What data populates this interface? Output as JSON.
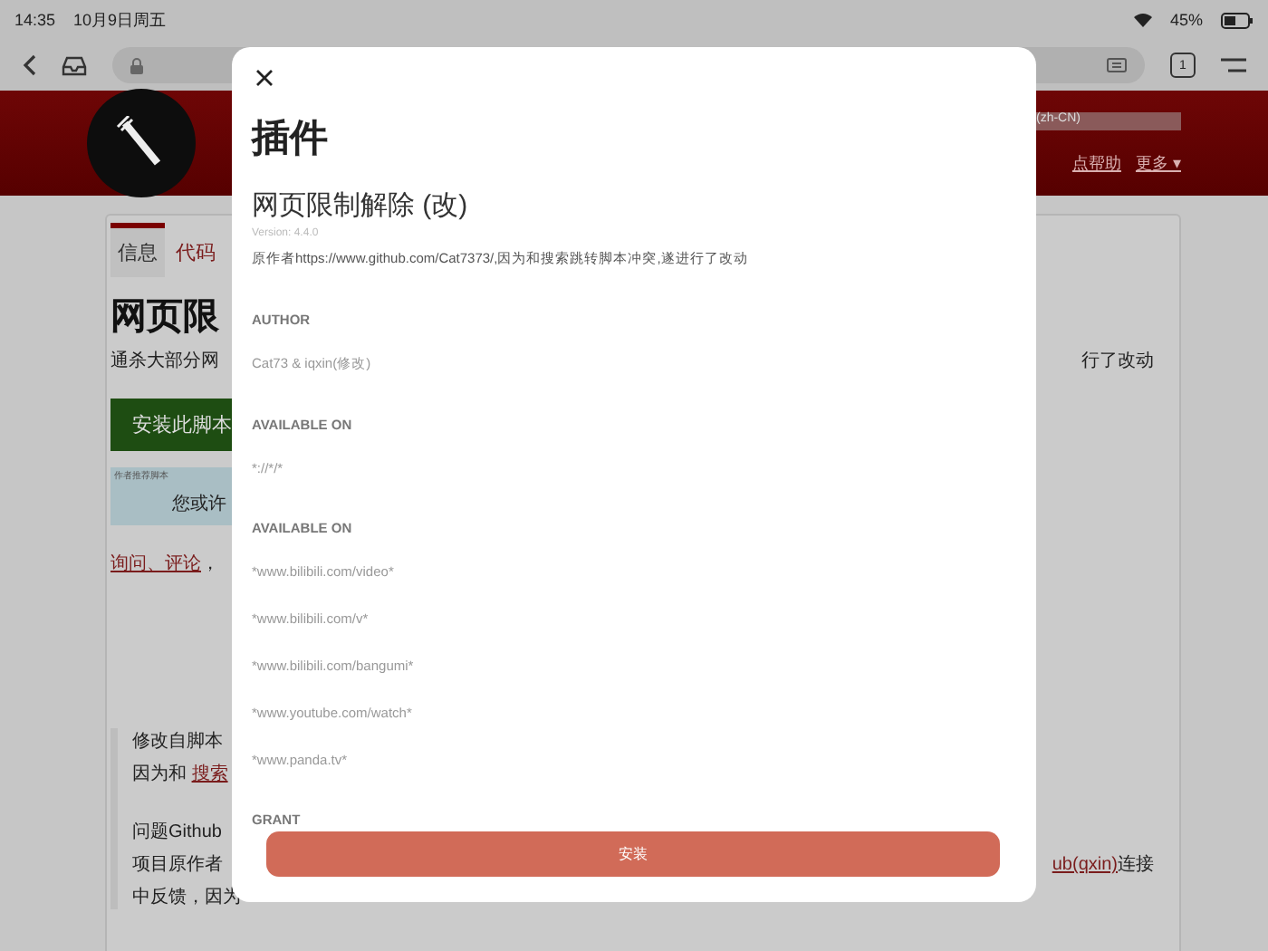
{
  "status_bar": {
    "time": "14:35",
    "date": "10月9日周五",
    "battery": "45%"
  },
  "browser": {
    "tab_count": "1"
  },
  "site_header": {
    "language": "(zh-CN)",
    "links": [
      "点帮助",
      "更多 ▾"
    ]
  },
  "tabs": [
    {
      "label": "信息",
      "selected": true
    },
    {
      "label": "代码",
      "selected": false
    }
  ],
  "script_page": {
    "title": "网页限",
    "subtitle": "通杀大部分网",
    "subtitle_end": "行了改动",
    "install_button": "安装此脚本",
    "recommend_label": "作者推荐脚本",
    "recommend_text": "您或许",
    "feedback_link": "询问、评论",
    "feedback_text": "，",
    "description": [
      [
        {
          "text": "修改自脚本"
        },
        {
          "text": "因为和 ",
          "link": "搜索"
        }
      ],
      [
        {
          "text": "问题Github"
        },
        {
          "text": "项目原作者",
          "end_link": "ub(qxin)",
          "end_text": "连接"
        },
        {
          "text": "中反馈，因为"
        }
      ]
    ]
  },
  "modal": {
    "title": "插件",
    "name": "网页限制解除 (改)",
    "version": "Version: 4.4.0",
    "description": "原作者https://www.github.com/Cat7373/,因为和搜索跳转脚本冲突,遂进行了改动",
    "sections": [
      {
        "label": "AUTHOR",
        "values": [
          "Cat73 & iqxin(修改)"
        ]
      },
      {
        "label": "AVAILABLE ON",
        "values": [
          "*://*/*"
        ]
      },
      {
        "label": "AVAILABLE ON",
        "values": [
          "*www.bilibili.com/video*",
          "*www.bilibili.com/v*",
          "*www.bilibili.com/bangumi*",
          "*www.youtube.com/watch*",
          "*www.panda.tv*"
        ]
      },
      {
        "label": "GRANT"
      }
    ],
    "install_button": "安装"
  }
}
